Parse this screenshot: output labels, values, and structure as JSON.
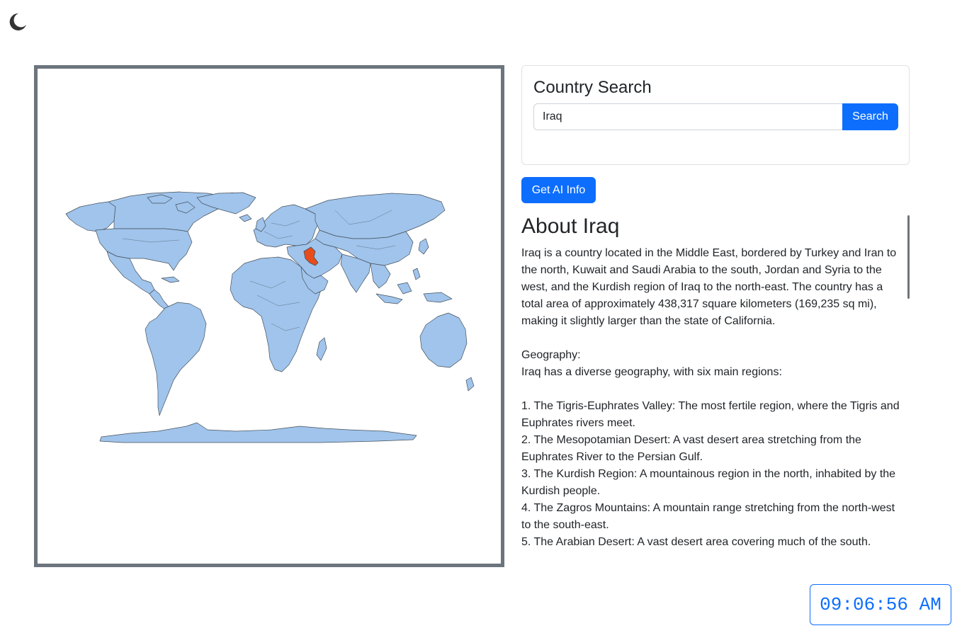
{
  "theme": {
    "toggle_icon": "moon-icon"
  },
  "map": {
    "highlighted_country": "Iraq",
    "land_color": "#a0c4eb",
    "border_color": "#45505c",
    "highlight_color": "#e84c1c",
    "frame_color": "#6c757d"
  },
  "search": {
    "title": "Country Search",
    "value": "Iraq",
    "button_label": "Search"
  },
  "ai": {
    "button_label": "Get AI Info"
  },
  "info": {
    "title": "About Iraq",
    "body": "Iraq is a country located in the Middle East, bordered by Turkey and Iran to the north, Kuwait and Saudi Arabia to the south, Jordan and Syria to the west, and the Kurdish region of Iraq to the north-east. The country has a total area of approximately 438,317 square kilometers (169,235 sq mi), making it slightly larger than the state of California.\n\nGeography:\nIraq has a diverse geography, with six main regions:\n\n1. The Tigris-Euphrates Valley: The most fertile region, where the Tigris and Euphrates rivers meet.\n2. The Mesopotamian Desert: A vast desert area stretching from the Euphrates River to the Persian Gulf.\n3. The Kurdish Region: A mountainous region in the north, inhabited by the Kurdish people.\n4. The Zagros Mountains: A mountain range stretching from the north-west to the south-east.\n5. The Arabian Desert: A vast desert area covering much of the south."
  },
  "clock": {
    "time": "09:06:56 AM"
  },
  "colors": {
    "primary": "#0d6efd",
    "text": "#212529",
    "border": "#dee2e6"
  }
}
